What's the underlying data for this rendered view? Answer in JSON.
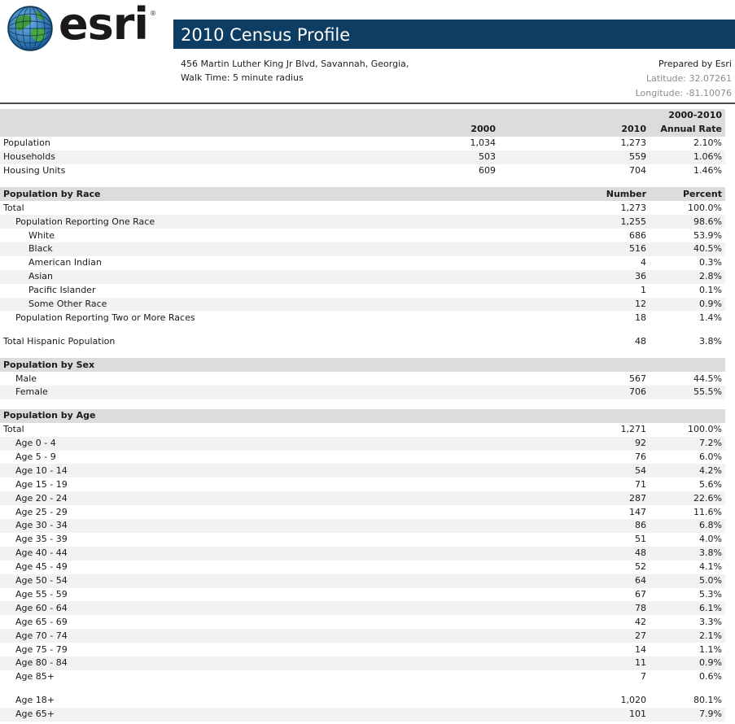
{
  "header": {
    "title": "2010 Census Profile",
    "address_line1": "456 Martin Luther King Jr Blvd, Savannah, Georgia,",
    "address_line2": "Walk Time: 5 minute radius",
    "prepared_by": "Prepared by Esri",
    "latitude": "Latitude: 32.07261",
    "longitude": "Longitude: -81.10076",
    "logo_text": "esri",
    "logo_mark": "®",
    "colors": {
      "title_bar": "#0d3d63",
      "section_header": "#dcdcdc"
    }
  },
  "summary": {
    "col_rate_line1": "2000-2010",
    "col_2000": "2000",
    "col_2010": "2010",
    "col_rate_line2": "Annual Rate",
    "rows": [
      {
        "label": "Population",
        "v2000": "1,034",
        "v2010": "1,273",
        "rate": "2.10%"
      },
      {
        "label": "Households",
        "v2000": "503",
        "v2010": "559",
        "rate": "1.06%"
      },
      {
        "label": "Housing Units",
        "v2000": "609",
        "v2010": "704",
        "rate": "1.46%"
      }
    ]
  },
  "race": {
    "title": "Population by Race",
    "col_number": "Number",
    "col_percent": "Percent",
    "rows": [
      {
        "label": "Total",
        "number": "1,273",
        "percent": "100.0%"
      },
      {
        "label": "Population Reporting One Race",
        "number": "1,255",
        "percent": "98.6%"
      },
      {
        "label": "White",
        "number": "686",
        "percent": "53.9%"
      },
      {
        "label": "Black",
        "number": "516",
        "percent": "40.5%"
      },
      {
        "label": "American Indian",
        "number": "4",
        "percent": "0.3%"
      },
      {
        "label": "Asian",
        "number": "36",
        "percent": "2.8%"
      },
      {
        "label": "Pacific Islander",
        "number": "1",
        "percent": "0.1%"
      },
      {
        "label": "Some Other Race",
        "number": "12",
        "percent": "0.9%"
      },
      {
        "label": "Population Reporting Two or More Races",
        "number": "18",
        "percent": "1.4%"
      }
    ],
    "hispanic": {
      "label": "Total Hispanic Population",
      "number": "48",
      "percent": "3.8%"
    }
  },
  "sex": {
    "title": "Population by Sex",
    "rows": [
      {
        "label": "Male",
        "number": "567",
        "percent": "44.5%"
      },
      {
        "label": "Female",
        "number": "706",
        "percent": "55.5%"
      }
    ]
  },
  "age": {
    "title": "Population by Age",
    "rows": [
      {
        "label": "Total",
        "number": "1,271",
        "percent": "100.0%"
      },
      {
        "label": "Age 0 - 4",
        "number": "92",
        "percent": "7.2%"
      },
      {
        "label": "Age 5 - 9",
        "number": "76",
        "percent": "6.0%"
      },
      {
        "label": "Age 10 - 14",
        "number": "54",
        "percent": "4.2%"
      },
      {
        "label": "Age 15 - 19",
        "number": "71",
        "percent": "5.6%"
      },
      {
        "label": "Age 20 - 24",
        "number": "287",
        "percent": "22.6%"
      },
      {
        "label": "Age 25 - 29",
        "number": "147",
        "percent": "11.6%"
      },
      {
        "label": "Age 30 - 34",
        "number": "86",
        "percent": "6.8%"
      },
      {
        "label": "Age 35 - 39",
        "number": "51",
        "percent": "4.0%"
      },
      {
        "label": "Age 40 - 44",
        "number": "48",
        "percent": "3.8%"
      },
      {
        "label": "Age 45 - 49",
        "number": "52",
        "percent": "4.1%"
      },
      {
        "label": "Age 50 - 54",
        "number": "64",
        "percent": "5.0%"
      },
      {
        "label": "Age 55 - 59",
        "number": "67",
        "percent": "5.3%"
      },
      {
        "label": "Age 60 - 64",
        "number": "78",
        "percent": "6.1%"
      },
      {
        "label": "Age 65 - 69",
        "number": "42",
        "percent": "3.3%"
      },
      {
        "label": "Age 70 - 74",
        "number": "27",
        "percent": "2.1%"
      },
      {
        "label": "Age 75 - 79",
        "number": "14",
        "percent": "1.1%"
      },
      {
        "label": "Age 80 - 84",
        "number": "11",
        "percent": "0.9%"
      },
      {
        "label": "Age 85+",
        "number": "7",
        "percent": "0.6%"
      }
    ],
    "extra": [
      {
        "label": "Age 18+",
        "number": "1,020",
        "percent": "80.1%"
      },
      {
        "label": "Age 65+",
        "number": "101",
        "percent": "7.9%"
      }
    ]
  }
}
